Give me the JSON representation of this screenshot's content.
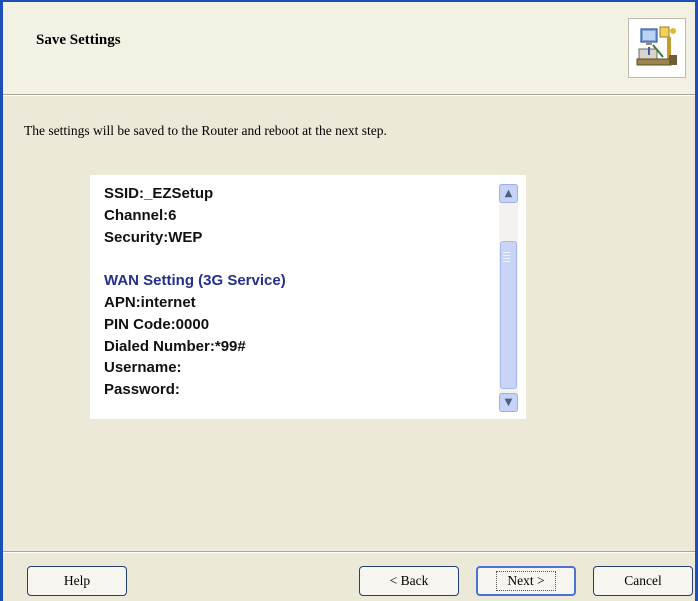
{
  "header": {
    "title": "Save Settings",
    "icon": "network-computers-icon"
  },
  "main": {
    "intro": "The settings will be saved to the Router and reboot at the next step.",
    "summary_lines": [
      "SSID:_EZSetup",
      "Channel:6",
      "Security:WEP",
      "",
      "WAN Setting  (3G Service)",
      "APN:internet",
      "PIN Code:0000",
      "Dialed Number:*99#",
      "Username:",
      "Password:"
    ]
  },
  "buttons": {
    "help": "Help",
    "back": "< Back",
    "next": "Next >",
    "cancel": "Cancel"
  },
  "colors": {
    "accent": "#25308e",
    "frame": "#1c4fb8",
    "panel": "#ece9d8"
  }
}
